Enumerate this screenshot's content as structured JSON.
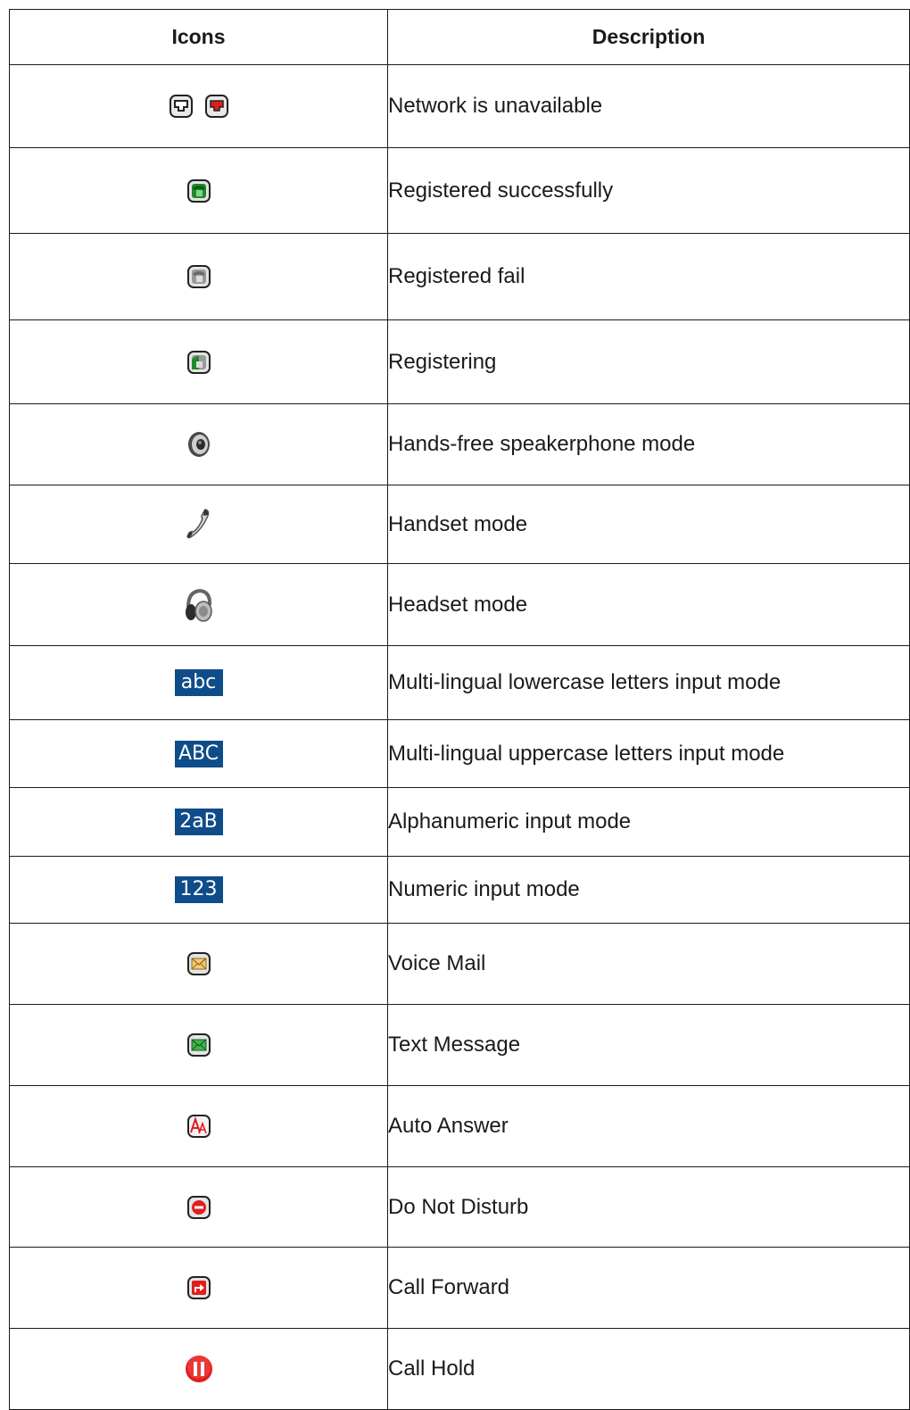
{
  "table": {
    "headers": {
      "icons": "Icons",
      "description": "Description"
    },
    "rows": [
      {
        "icons": [
          "network-unavailable-outline-icon",
          "network-unavailable-red-icon"
        ],
        "description": "Network is unavailable"
      },
      {
        "icons": [
          "phone-registered-green-icon"
        ],
        "description": "Registered successfully"
      },
      {
        "icons": [
          "phone-register-fail-gray-icon"
        ],
        "description": "Registered fail"
      },
      {
        "icons": [
          "phone-registering-icon"
        ],
        "description": "Registering"
      },
      {
        "icons": [
          "speaker-icon"
        ],
        "description": "Hands-free speakerphone mode"
      },
      {
        "icons": [
          "handset-icon"
        ],
        "description": "Handset mode"
      },
      {
        "icons": [
          "headset-icon"
        ],
        "description": "Headset mode"
      },
      {
        "icons": [
          "input-mode-abc-icon"
        ],
        "badge": "abc",
        "description": "Multi-lingual lowercase letters input mode"
      },
      {
        "icons": [
          "input-mode-ABC-icon"
        ],
        "badge": "ABC",
        "description": "Multi-lingual uppercase letters input mode"
      },
      {
        "icons": [
          "input-mode-2aB-icon"
        ],
        "badge": "2aB",
        "description": "Alphanumeric input mode"
      },
      {
        "icons": [
          "input-mode-123-icon"
        ],
        "badge": "123",
        "description": "Numeric input mode"
      },
      {
        "icons": [
          "voice-mail-envelope-icon"
        ],
        "description": "Voice Mail"
      },
      {
        "icons": [
          "text-message-envelope-icon"
        ],
        "description": "Text Message"
      },
      {
        "icons": [
          "auto-answer-icon"
        ],
        "description": "Auto Answer"
      },
      {
        "icons": [
          "do-not-disturb-icon"
        ],
        "description": "Do Not Disturb"
      },
      {
        "icons": [
          "call-forward-icon"
        ],
        "description": "Call Forward"
      },
      {
        "icons": [
          "call-hold-icon"
        ],
        "description": "Call Hold"
      }
    ]
  },
  "colors": {
    "badge_bg": "#0f4c8a",
    "status_red": "#e01e1e",
    "status_green": "#1f8a2a",
    "border": "#1a1a1a"
  }
}
